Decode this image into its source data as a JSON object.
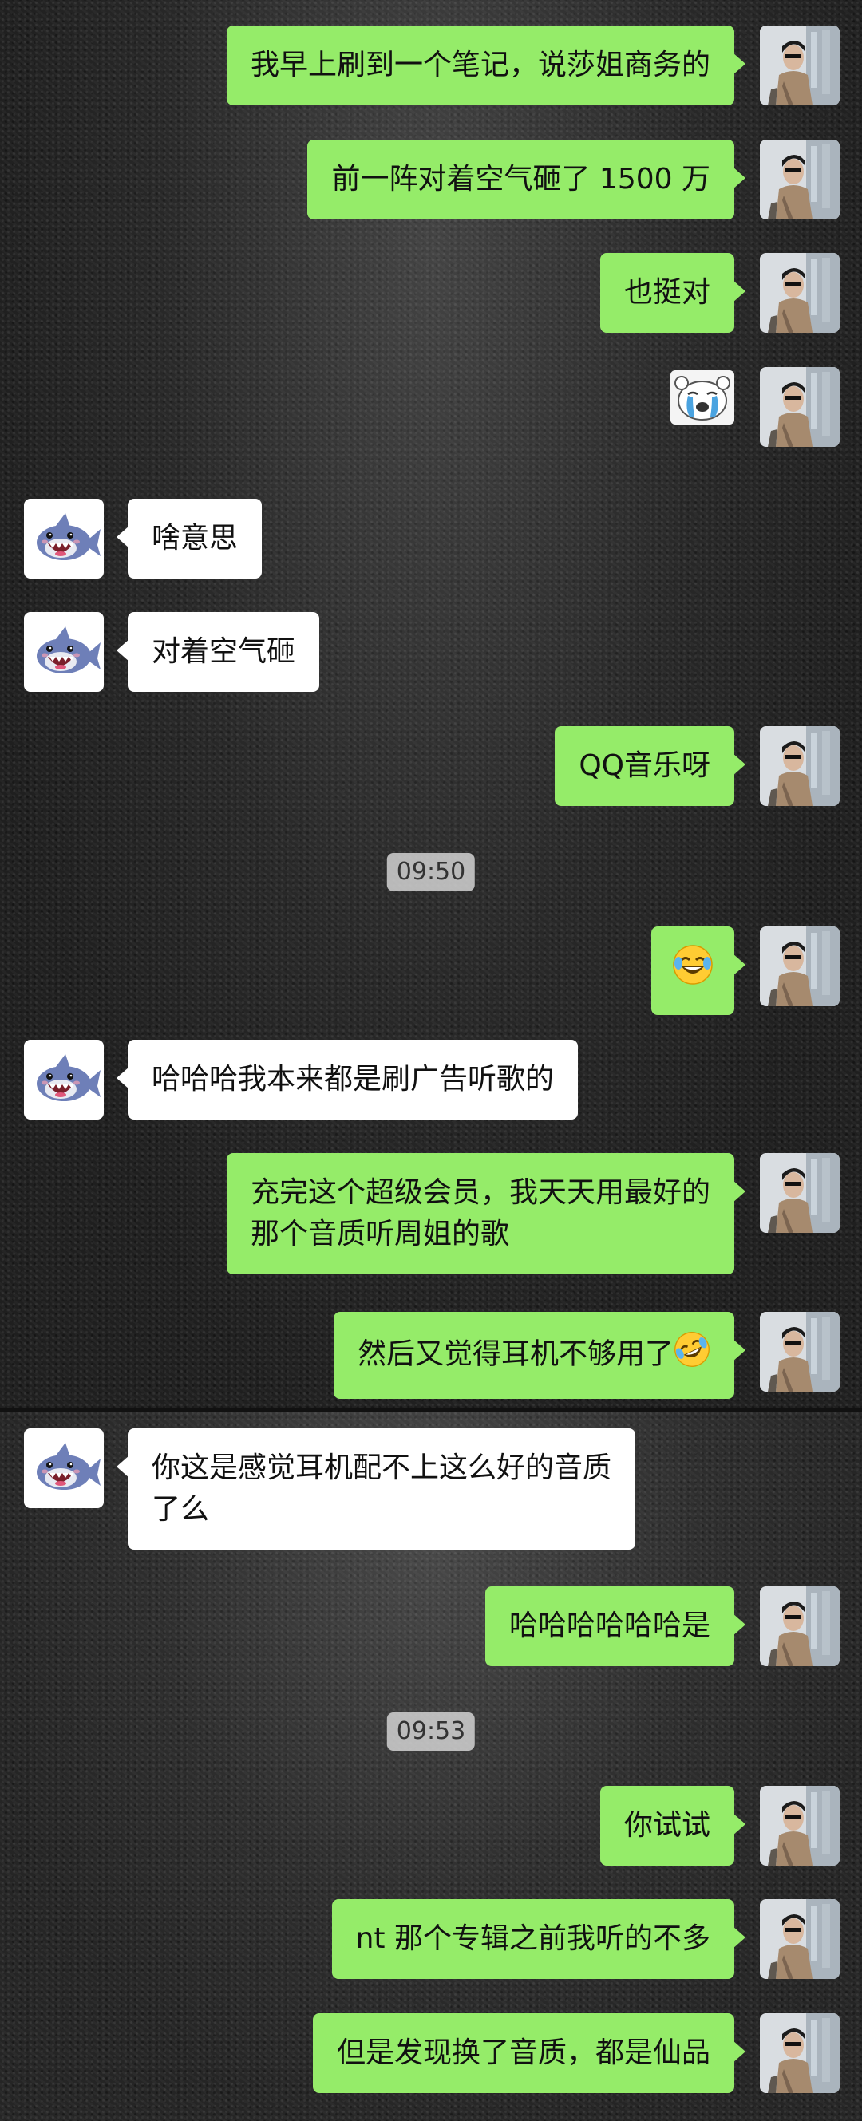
{
  "timestamps": [
    "09:50",
    "09:53"
  ],
  "messages": [
    {
      "side": "me",
      "text": "我早上刷到一个笔记，说莎姐商务的"
    },
    {
      "side": "me",
      "text": "前一阵对着空气砸了 1500 万"
    },
    {
      "side": "me",
      "text": "也挺对"
    },
    {
      "side": "me",
      "sticker": "crying-cartoon-sticker"
    },
    {
      "side": "them",
      "text": "啥意思"
    },
    {
      "side": "them",
      "text": "对着空气砸"
    },
    {
      "side": "me",
      "text": "QQ音乐呀"
    },
    {
      "side": "me",
      "emoji": "laughing-tears-emoji"
    },
    {
      "side": "them",
      "text": "哈哈哈我本来都是刷广告听歌的"
    },
    {
      "side": "me",
      "line1": "充完这个超级会员，我天天用最好的",
      "line2": "那个音质听周姐的歌"
    },
    {
      "side": "me",
      "text": "然后又觉得耳机不够用了",
      "emoji": "rofl-emoji"
    },
    {
      "side": "them",
      "line1": "你这是感觉耳机配不上这么好的音质",
      "line2": "了么"
    },
    {
      "side": "me",
      "text": "哈哈哈哈哈哈是"
    },
    {
      "side": "me",
      "text": "你试试"
    },
    {
      "side": "me",
      "text": "nt 那个专辑之前我听的不多"
    },
    {
      "side": "me",
      "text": "但是发现换了音质，都是仙品"
    }
  ],
  "colors": {
    "outgoing_bubble": "#95ec69",
    "incoming_bubble": "#ffffff",
    "background": "#202020"
  }
}
